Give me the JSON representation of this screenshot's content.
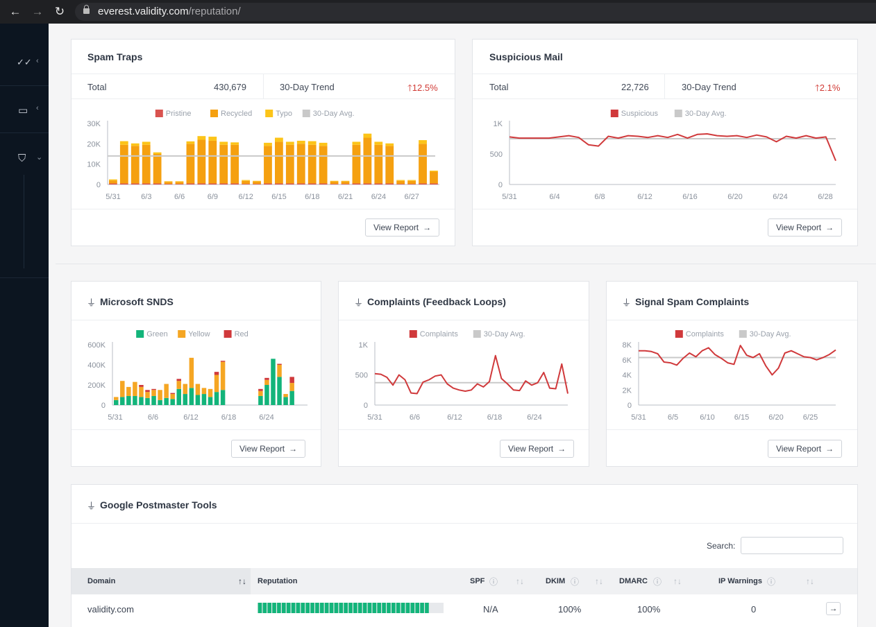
{
  "browser": {
    "back": "←",
    "forward": "→",
    "reload": "↻",
    "url_domain": "everest.validity.com",
    "url_path": "/reputation/"
  },
  "sidebar": {
    "items": [
      {
        "icon": "✓✓",
        "chevron": "‹",
        "name": "checks"
      },
      {
        "icon": "▭",
        "chevron": "‹",
        "name": "inbox"
      },
      {
        "icon": "⛉",
        "chevron": "⌄",
        "name": "shield"
      }
    ]
  },
  "spam_traps": {
    "title": "Spam Traps",
    "total_label": "Total",
    "total_value": "430,679",
    "trend_label": "30-Day Trend",
    "trend_value": "12.5%",
    "button": "View Report"
  },
  "suspicious": {
    "title": "Suspicious Mail",
    "total_label": "Total",
    "total_value": "22,726",
    "trend_label": "30-Day Trend",
    "trend_value": "2.1%",
    "button": "View Report"
  },
  "snds": {
    "title": "Microsoft SNDS",
    "button": "View Report"
  },
  "complaints": {
    "title": "Complaints (Feedback Loops)",
    "button": "View Report"
  },
  "signal": {
    "title": "Signal Spam Complaints",
    "button": "View Report"
  },
  "gpt": {
    "title": "Google Postmaster Tools",
    "search_label": "Search:",
    "columns": [
      "Domain",
      "Reputation",
      "SPF",
      "DKIM",
      "DMARC",
      "IP Warnings"
    ],
    "rows": [
      {
        "domain": "validity.com",
        "reputation": 0.92,
        "spf": "N/A",
        "dkim": "100%",
        "dmarc": "100%",
        "ip_warnings": "0"
      }
    ]
  },
  "colors": {
    "pristine": "#d9534f",
    "recycled": "#f5a010",
    "typo": "#fcc419",
    "avg": "#c9c9c9",
    "red": "#d0393b",
    "green": "#13b47a",
    "yellow": "#f5a623"
  },
  "chart_data": [
    {
      "id": "spam-traps",
      "type": "bar",
      "stacked": true,
      "legend": [
        "Pristine",
        "Recycled",
        "Typo",
        "30-Day Avg."
      ],
      "x": [
        "5/31",
        "6/1",
        "6/2",
        "6/3",
        "6/4",
        "6/5",
        "6/6",
        "6/7",
        "6/8",
        "6/9",
        "6/10",
        "6/11",
        "6/12",
        "6/13",
        "6/14",
        "6/15",
        "6/16",
        "6/17",
        "6/18",
        "6/19",
        "6/20",
        "6/21",
        "6/22",
        "6/23",
        "6/24",
        "6/25",
        "6/26",
        "6/27",
        "6/28",
        "6/29"
      ],
      "xticks": [
        "5/31",
        "6/3",
        "6/6",
        "6/9",
        "6/12",
        "6/15",
        "6/18",
        "6/21",
        "6/24",
        "6/27"
      ],
      "series": [
        {
          "name": "Pristine",
          "values": [
            500,
            500,
            500,
            500,
            500,
            300,
            300,
            500,
            500,
            500,
            500,
            500,
            300,
            300,
            500,
            500,
            500,
            500,
            500,
            500,
            300,
            300,
            500,
            500,
            500,
            500,
            300,
            300,
            500,
            500
          ]
        },
        {
          "name": "Recycled",
          "values": [
            1500,
            19000,
            18500,
            19000,
            14500,
            1000,
            1000,
            19500,
            21500,
            21000,
            19000,
            19000,
            1500,
            1200,
            18500,
            20500,
            19000,
            19500,
            19000,
            18500,
            1200,
            1200,
            19000,
            22500,
            19000,
            18500,
            1500,
            1500,
            19500,
            5800
          ]
        },
        {
          "name": "Typo",
          "values": [
            500,
            1800,
            1200,
            1500,
            800,
            300,
            300,
            1200,
            1800,
            2000,
            1500,
            1200,
            400,
            300,
            1500,
            2000,
            1500,
            1500,
            1800,
            1500,
            300,
            300,
            1500,
            2000,
            1500,
            1200,
            400,
            400,
            1800,
            500
          ]
        }
      ],
      "avg": 14000,
      "yticks": [
        "30K",
        "20K",
        "10K",
        "0"
      ],
      "ylim": [
        0,
        30000
      ]
    },
    {
      "id": "suspicious-mail",
      "type": "line",
      "legend": [
        "Suspicious",
        "30-Day Avg."
      ],
      "x": [
        "5/31",
        "6/1",
        "6/2",
        "6/3",
        "6/4",
        "6/5",
        "6/6",
        "6/7",
        "6/8",
        "6/9",
        "6/10",
        "6/11",
        "6/12",
        "6/13",
        "6/14",
        "6/15",
        "6/16",
        "6/17",
        "6/18",
        "6/19",
        "6/20",
        "6/21",
        "6/22",
        "6/23",
        "6/24",
        "6/25",
        "6/26",
        "6/27",
        "6/28",
        "6/29"
      ],
      "xticks": [
        "5/31",
        "6/4",
        "6/8",
        "6/12",
        "6/16",
        "6/20",
        "6/24",
        "6/28"
      ],
      "values": [
        780,
        760,
        760,
        760,
        760,
        780,
        800,
        770,
        650,
        630,
        790,
        760,
        800,
        790,
        770,
        800,
        770,
        820,
        760,
        820,
        830,
        800,
        790,
        800,
        770,
        810,
        780,
        700,
        790,
        760,
        800,
        760,
        780,
        390
      ],
      "avg": 750,
      "yticks": [
        "1K",
        "500",
        "0"
      ],
      "ylim": [
        0,
        1000
      ]
    },
    {
      "id": "snds",
      "type": "bar",
      "stacked": true,
      "legend": [
        "Green",
        "Yellow",
        "Red"
      ],
      "xticks": [
        "5/31",
        "6/6",
        "6/12",
        "6/18",
        "6/24"
      ],
      "series": [
        {
          "name": "Green",
          "values": [
            50000,
            80000,
            90000,
            90000,
            80000,
            70000,
            90000,
            50000,
            70000,
            60000,
            160000,
            110000,
            170000,
            100000,
            110000,
            80000,
            130000,
            150000,
            0,
            0,
            0,
            0,
            0,
            90000,
            200000,
            460000,
            280000,
            80000,
            140000
          ]
        },
        {
          "name": "Yellow",
          "values": [
            30000,
            160000,
            90000,
            140000,
            100000,
            60000,
            60000,
            100000,
            140000,
            50000,
            80000,
            100000,
            300000,
            110000,
            60000,
            80000,
            170000,
            280000,
            0,
            0,
            0,
            0,
            0,
            50000,
            50000,
            0,
            120000,
            30000,
            80000
          ]
        },
        {
          "name": "Red",
          "values": [
            0,
            0,
            0,
            0,
            20000,
            20000,
            10000,
            0,
            0,
            10000,
            20000,
            0,
            0,
            0,
            0,
            0,
            30000,
            10000,
            0,
            0,
            0,
            0,
            0,
            20000,
            20000,
            0,
            10000,
            0,
            60000
          ]
        }
      ],
      "yticks": [
        "600K",
        "400K",
        "200K",
        "0"
      ],
      "ylim": [
        0,
        600000
      ]
    },
    {
      "id": "complaints",
      "type": "line",
      "legend": [
        "Complaints",
        "30-Day Avg."
      ],
      "xticks": [
        "5/31",
        "6/6",
        "6/12",
        "6/18",
        "6/24"
      ],
      "values": [
        520,
        510,
        460,
        330,
        500,
        420,
        200,
        190,
        380,
        420,
        480,
        500,
        350,
        280,
        250,
        230,
        250,
        350,
        300,
        390,
        820,
        440,
        350,
        250,
        240,
        400,
        330,
        370,
        540,
        280,
        270,
        680,
        190
      ],
      "avg": 370,
      "yticks": [
        "1K",
        "500",
        "0"
      ],
      "ylim": [
        0,
        1000
      ]
    },
    {
      "id": "signal",
      "type": "line",
      "legend": [
        "Complaints",
        "30-Day Avg."
      ],
      "xticks": [
        "5/31",
        "6/5",
        "6/10",
        "6/15",
        "6/20",
        "6/25"
      ],
      "values": [
        7200,
        7200,
        7100,
        6800,
        5700,
        5600,
        5300,
        6200,
        6900,
        6400,
        7200,
        7600,
        6700,
        6200,
        5600,
        5400,
        7900,
        6600,
        6300,
        6800,
        5200,
        4000,
        4900,
        6900,
        7200,
        6800,
        6400,
        6300,
        6000,
        6300,
        6700,
        7300
      ],
      "avg": 6300,
      "yticks": [
        "8K",
        "6K",
        "4K",
        "2K",
        "0"
      ],
      "ylim": [
        0,
        8000
      ]
    }
  ]
}
